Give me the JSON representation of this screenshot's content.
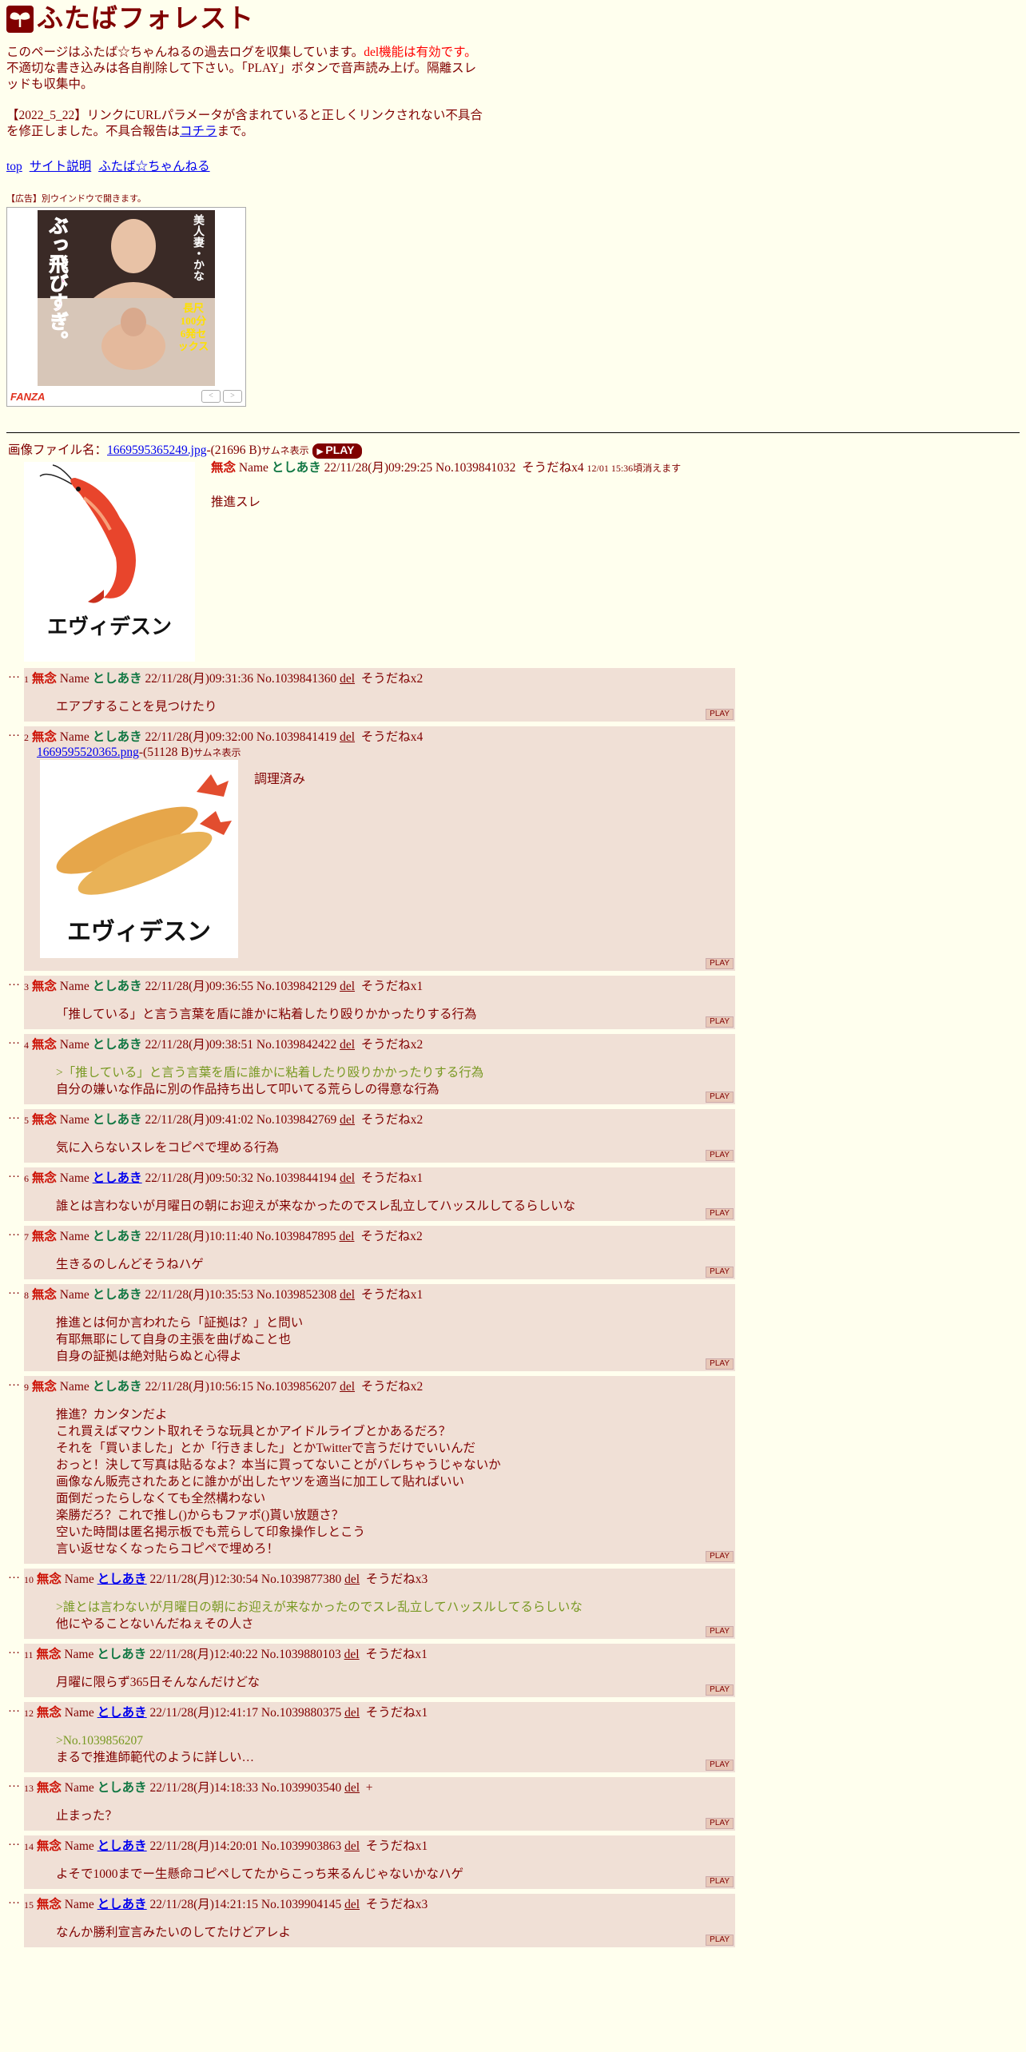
{
  "header": {
    "title": "ふたばフォレスト",
    "intro_pre": "このページはふたば☆ちゃんねるの過去ログを収集しています。",
    "intro_red": "del機能は有効です。",
    "intro_post": "不適切な書き込みは各自削除して下さい。「PLAY」ボタンで音声読み上げ。隔離スレッドも収集中。",
    "notice_pre": "【2022_5_22】リンクにURLパラメータが含まれていると正しくリンクされない不具合を修正しました。不具合報告は",
    "notice_link": "コチラ",
    "notice_post": "まで。"
  },
  "nav": {
    "top": "top",
    "about": "サイト説明",
    "futaba": "ふたば☆ちゃんねる"
  },
  "ad": {
    "label": "【広告】別ウインドウで開きます。",
    "logo": "FANZA",
    "img_caption": "ぶっ飛びすぎ。",
    "img_sub": "美人妻・かな",
    "img_badge": "長尺100分 6発セックス",
    "prev": "<",
    "next": ">"
  },
  "op": {
    "file_label": "画像ファイル名：",
    "file_name": "1669595365249.jpg",
    "file_size": "-(21696 B)",
    "thumb_label": "サムネ表示",
    "play_button": "PLAY",
    "subject": "無念",
    "name_label": "Name",
    "name": "としあき",
    "datetime": "22/11/28(月)09:29:25",
    "number": "No.1039841032",
    "soudane": "そうだねx4",
    "expire": "12/01 15:36頃消えます",
    "body": "推進スレ",
    "thumb_text": "エヴィデスン"
  },
  "dots": "…",
  "replies": [
    {
      "n": "1",
      "subj": "無念",
      "name": "としあき",
      "link": false,
      "dt": "22/11/28(月)09:31:36",
      "no": "No.1039841360",
      "del": "del",
      "sd": "そうだねx2",
      "lines": [
        {
          "t": "エアプすることを見つけたり",
          "q": false
        }
      ]
    },
    {
      "n": "2",
      "subj": "無念",
      "name": "としあき",
      "link": false,
      "dt": "22/11/28(月)09:32:00",
      "no": "No.1039841419",
      "del": "del",
      "sd": "そうだねx4",
      "img": true,
      "img_name": "1669595520365.png",
      "img_size": "-(51128 B)",
      "img_thumb": "サムネ表示",
      "img_text": "エヴィデスン",
      "lines": [
        {
          "t": "調理済み",
          "q": false
        }
      ]
    },
    {
      "n": "3",
      "subj": "無念",
      "name": "としあき",
      "link": false,
      "dt": "22/11/28(月)09:36:55",
      "no": "No.1039842129",
      "del": "del",
      "sd": "そうだねx1",
      "lines": [
        {
          "t": "「推している」と言う言葉を盾に誰かに粘着したり殴りかかったりする行為",
          "q": false
        }
      ]
    },
    {
      "n": "4",
      "subj": "無念",
      "name": "としあき",
      "link": false,
      "dt": "22/11/28(月)09:38:51",
      "no": "No.1039842422",
      "del": "del",
      "sd": "そうだねx2",
      "lines": [
        {
          "t": ">「推している」と言う言葉を盾に誰かに粘着したり殴りかかったりする行為",
          "q": true
        },
        {
          "t": "自分の嫌いな作品に別の作品持ち出して叩いてる荒らしの得意な行為",
          "q": false
        }
      ]
    },
    {
      "n": "5",
      "subj": "無念",
      "name": "としあき",
      "link": false,
      "dt": "22/11/28(月)09:41:02",
      "no": "No.1039842769",
      "del": "del",
      "sd": "そうだねx2",
      "lines": [
        {
          "t": "気に入らないスレをコピペで埋める行為",
          "q": false
        }
      ]
    },
    {
      "n": "6",
      "subj": "無念",
      "name": "としあき",
      "link": true,
      "dt": "22/11/28(月)09:50:32",
      "no": "No.1039844194",
      "del": "del",
      "sd": "そうだねx1",
      "lines": [
        {
          "t": "誰とは言わないが月曜日の朝にお迎えが来なかったのでスレ乱立してハッスルしてるらしいな",
          "q": false
        }
      ]
    },
    {
      "n": "7",
      "subj": "無念",
      "name": "としあき",
      "link": false,
      "dt": "22/11/28(月)10:11:40",
      "no": "No.1039847895",
      "del": "del",
      "sd": "そうだねx2",
      "lines": [
        {
          "t": "生きるのしんどそうねハゲ",
          "q": false
        }
      ]
    },
    {
      "n": "8",
      "subj": "無念",
      "name": "としあき",
      "link": false,
      "dt": "22/11/28(月)10:35:53",
      "no": "No.1039852308",
      "del": "del",
      "sd": "そうだねx1",
      "lines": [
        {
          "t": "推進とは何か言われたら「証拠は？」と問い",
          "q": false
        },
        {
          "t": "有耶無耶にして自身の主張を曲げぬこと也",
          "q": false
        },
        {
          "t": "自身の証拠は絶対貼らぬと心得よ",
          "q": false
        }
      ]
    },
    {
      "n": "9",
      "subj": "無念",
      "name": "としあき",
      "link": false,
      "dt": "22/11/28(月)10:56:15",
      "no": "No.1039856207",
      "del": "del",
      "sd": "そうだねx2",
      "lines": [
        {
          "t": "推進？カンタンだよ",
          "q": false
        },
        {
          "t": "これ買えばマウント取れそうな玩具とかアイドルライブとかあるだろ？",
          "q": false
        },
        {
          "t": "それを「買いました」とか「行きました」とかTwitterで言うだけでいいんだ",
          "q": false
        },
        {
          "t": "おっと！決して写真は貼るなよ？本当に買ってないことがバレちゃうじゃないか",
          "q": false
        },
        {
          "t": "画像なん販売されたあとに誰かが出したヤツを適当に加工して貼ればいい",
          "q": false
        },
        {
          "t": "面倒だったらしなくても全然構わない",
          "q": false
        },
        {
          "t": "楽勝だろ？これで推し()からもファボ()貰い放題さ？",
          "q": false
        },
        {
          "t": "空いた時間は匿名掲示板でも荒らして印象操作しとこう",
          "q": false
        },
        {
          "t": "言い返せなくなったらコピペで埋めろ！",
          "q": false
        }
      ]
    },
    {
      "n": "10",
      "subj": "無念",
      "name": "としあき",
      "link": true,
      "dt": "22/11/28(月)12:30:54",
      "no": "No.1039877380",
      "del": "del",
      "sd": "そうだねx3",
      "lines": [
        {
          "t": ">誰とは言わないが月曜日の朝にお迎えが来なかったのでスレ乱立してハッスルしてるらしいな",
          "q": true
        },
        {
          "t": "他にやることないんだねぇその人さ",
          "q": false
        }
      ]
    },
    {
      "n": "11",
      "subj": "無念",
      "name": "としあき",
      "link": false,
      "dt": "22/11/28(月)12:40:22",
      "no": "No.1039880103",
      "del": "del",
      "sd": "そうだねx1",
      "lines": [
        {
          "t": "月曜に限らず365日そんなんだけどな",
          "q": false
        }
      ]
    },
    {
      "n": "12",
      "subj": "無念",
      "name": "としあき",
      "link": true,
      "dt": "22/11/28(月)12:41:17",
      "no": "No.1039880375",
      "del": "del",
      "sd": "そうだねx1",
      "lines": [
        {
          "t": ">No.1039856207",
          "q": true
        },
        {
          "t": "まるで推進師範代のように詳しい…",
          "q": false
        }
      ]
    },
    {
      "n": "13",
      "subj": "無念",
      "name": "としあき",
      "link": false,
      "dt": "22/11/28(月)14:18:33",
      "no": "No.1039903540",
      "del": "del",
      "sd": "+",
      "lines": [
        {
          "t": "止まった？",
          "q": false
        }
      ]
    },
    {
      "n": "14",
      "subj": "無念",
      "name": "としあき",
      "link": true,
      "dt": "22/11/28(月)14:20:01",
      "no": "No.1039903863",
      "del": "del",
      "sd": "そうだねx1",
      "lines": [
        {
          "t": "よそで1000までー生懸命コピペしてたからこっち来るんじゃないかなハゲ",
          "q": false
        }
      ]
    },
    {
      "n": "15",
      "subj": "無念",
      "name": "としあき",
      "link": true,
      "dt": "22/11/28(月)14:21:15",
      "no": "No.1039904145",
      "del": "del",
      "sd": "そうだねx3",
      "lines": [
        {
          "t": "なんか勝利宣言みたいのしてたけどアレよ",
          "q": false
        }
      ]
    }
  ],
  "play_label": "PLAY",
  "colors": {
    "background": "#ffffee",
    "text": "#800000",
    "reply_bg": "#f0e0d6",
    "subject": "#cc1105",
    "name": "#117743",
    "quote": "#789922",
    "link": "#0000ee",
    "alert": "#ff0000"
  }
}
